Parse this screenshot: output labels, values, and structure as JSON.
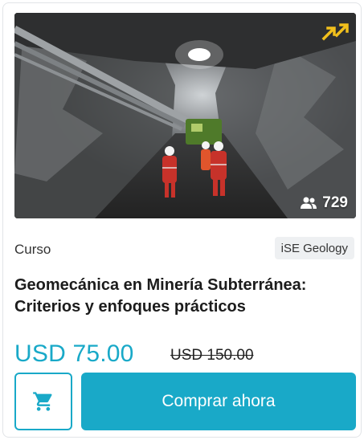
{
  "course": {
    "type": "Curso",
    "provider": "iSE Geology",
    "title_line1": "Geomecánica en Minería Subterránea:",
    "title_line2": "Criterios y enfoques prácticos",
    "price": "USD 75.00",
    "original_price": "USD 150.00",
    "students": "729"
  },
  "actions": {
    "buy_label": "Comprar ahora",
    "cart_icon": "shopping-cart-icon"
  },
  "badges": {
    "trending_icon": "trending-arrows-icon",
    "students_icon": "group-icon"
  },
  "colors": {
    "accent": "#19a9c8",
    "trend_yellow": "#f2c01c"
  }
}
